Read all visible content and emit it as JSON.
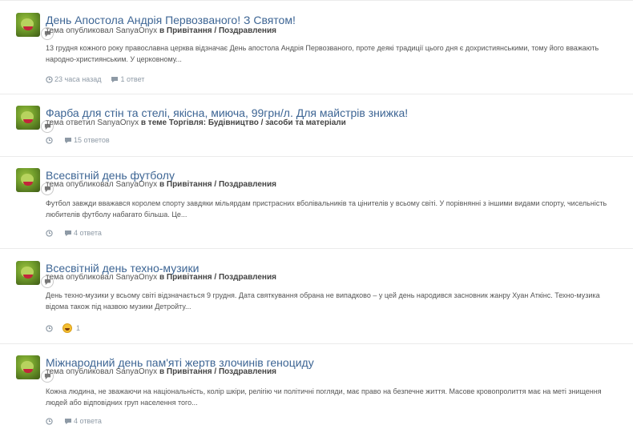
{
  "items": [
    {
      "title": "День Апостола Андрія Первозваного! З Святом!",
      "meta_prefix": "тема опубликовал",
      "user": "SanyaOnyx",
      "meta_in": "в",
      "forum": "Привітання / Поздравления",
      "snippet": "13 грудня кожного року православна церква відзначає День апостола Андрія Первозваного, проте деякі традиції цього дня є дохристиянськими, тому його вважають народно-християнським. У церковному...",
      "time": "23 часа назад",
      "replies": "1 ответ"
    },
    {
      "title": "Фарба для стін та стелі, якісна, миюча, 99грн/л. Для майстрів знижка!",
      "meta_prefix": "тема ответил",
      "user": "SanyaOnyx",
      "meta_in": "в теме",
      "forum": "Торгівля: Будівництво / засоби та матеріали",
      "replies": "15 ответов"
    },
    {
      "title": "Всесвітній день футболу",
      "meta_prefix": "тема опубликовал",
      "user": "SanyaOnyx",
      "meta_in": "в",
      "forum": "Привітання / Поздравления",
      "snippet": "Футбол завжди вважався королем спорту завдяки мільярдам пристрасних вболівальників та цінителів у всьому світі. У порівнянні з іншими видами спорту, чисельність любителів футболу набагато більша. Це...",
      "replies": "4 ответа"
    },
    {
      "title": "Всесвітній день техно-музики",
      "meta_prefix": "тема опубликовал",
      "user": "SanyaOnyx",
      "meta_in": "в",
      "forum": "Привітання / Поздравления",
      "snippet": "День техно-музики у всьому світі відзначається 9 грудня. Дата святкування обрана не випадково – у цей день народився засновник жанру Хуан Аткінс. Техно-музика відома також під назвою музики Детройту...",
      "reaction_count": "1"
    },
    {
      "title": "Міжнародний день пам'яті жертв злочинів геноциду",
      "meta_prefix": "тема опубликовал",
      "user": "SanyaOnyx",
      "meta_in": "в",
      "forum": "Привітання / Поздравления",
      "snippet": "Кожна людина, не зважаючи на національність, колір шкіри, релігію чи політичні погляди, має право на безпечне життя. Масове кровопролиття має на меті знищення людей або відповідних груп населення того...",
      "replies": "4 ответа"
    }
  ]
}
